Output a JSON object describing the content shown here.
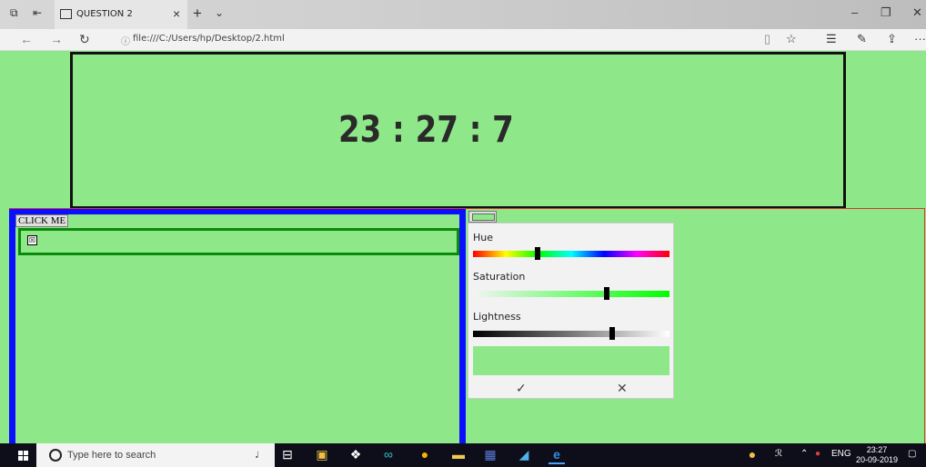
{
  "browser": {
    "tab_title": "QUESTION 2",
    "tab_close": "×",
    "new_tab": "+",
    "tab_list": "⌄",
    "url": "file:///C:/Users/hp/Desktop/2.html",
    "window_controls": {
      "minimize": "–",
      "maximize": "❐",
      "close": "✕"
    },
    "nav": {
      "back": "←",
      "forward": "→",
      "refresh": "↻"
    },
    "url_info_icon": "ⓘ",
    "toolbar_icons": {
      "reading_view": "▯",
      "favorite": "☆",
      "favorites_hub": "☰",
      "notes": "✎",
      "share": "⇪",
      "more": "···"
    }
  },
  "clock": {
    "time": "23 : 27 : 7"
  },
  "panel": {
    "button_label": "CLICK ME",
    "checkbox_mark": "☒"
  },
  "color_picker": {
    "hue_label": "Hue",
    "saturation_label": "Saturation",
    "lightness_label": "Lightness",
    "hue_value": 0.33,
    "saturation_value": 0.68,
    "lightness_value": 0.71,
    "selected_color": "#8ee88a",
    "confirm_label": "✓",
    "cancel_label": "✕"
  },
  "taskbar": {
    "search_placeholder": "Type here to search",
    "tray": {
      "language": "ENG",
      "time": "23:27",
      "date": "20-09-2019"
    }
  },
  "colors": {
    "page_background": "#8ee88a",
    "panel_border": "#0a10ff",
    "row_border": "#0a8a0a",
    "outer_border": "#e53030"
  }
}
